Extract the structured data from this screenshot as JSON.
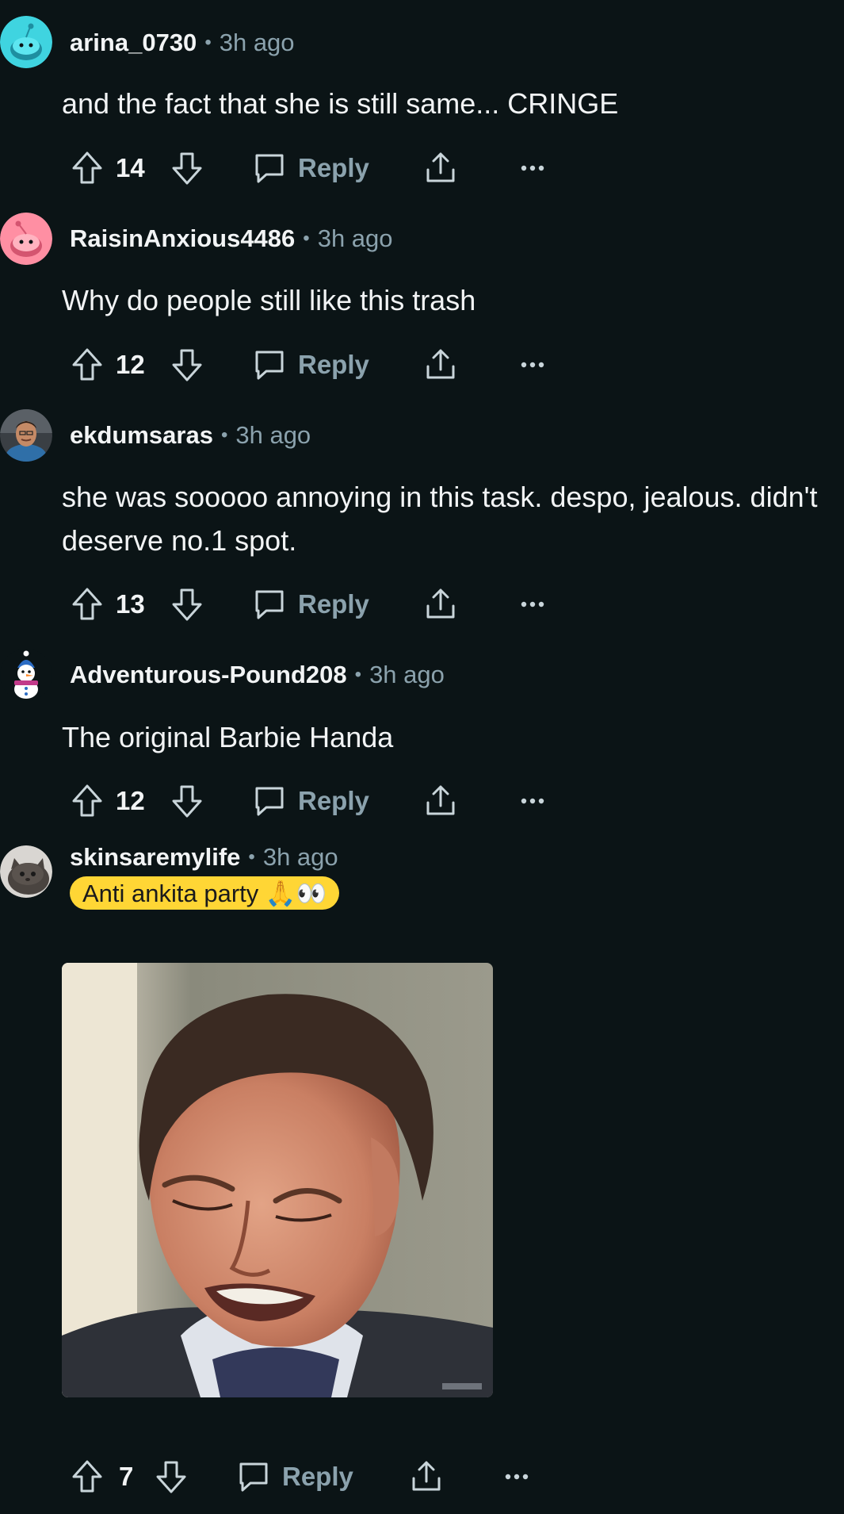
{
  "comments": [
    {
      "username": "arina_0730",
      "time": "3h ago",
      "text": "and the fact that she is still same... CRINGE",
      "score": "14",
      "reply_label": "Reply",
      "avatar": "reddit-snoo-cyan-avatar"
    },
    {
      "username": "RaisinAnxious4486",
      "time": "3h ago",
      "text": "Why do people still like this trash",
      "score": "12",
      "reply_label": "Reply",
      "avatar": "reddit-snoo-pink-avatar"
    },
    {
      "username": "ekdumsaras",
      "time": "3h ago",
      "text": "she was sooooo annoying in this task. despo, jealous. didn't deserve no.1 spot.",
      "score": "13",
      "reply_label": "Reply",
      "avatar": "user-photo-avatar"
    },
    {
      "username": "Adventurous-Pound208",
      "time": "3h ago",
      "text": "The original Barbie Handa",
      "score": "12",
      "reply_label": "Reply",
      "avatar": "snowman-character-avatar"
    },
    {
      "username": "skinsaremylife",
      "time": "3h ago",
      "flair": "Anti ankita party 🙏👀",
      "score": "7",
      "reply_label": "Reply",
      "avatar": "cat-photo-avatar",
      "media": "cringing-man-gif"
    }
  ],
  "colors": {
    "background": "#0b1416",
    "text_primary": "#f2f4f5",
    "text_secondary": "#8ba2ad",
    "flair_background": "#ffd635",
    "icon_stroke": "#c9d5da"
  },
  "icons": [
    "upvote-icon",
    "downvote-icon",
    "comment-icon",
    "share-icon",
    "more-icon"
  ]
}
